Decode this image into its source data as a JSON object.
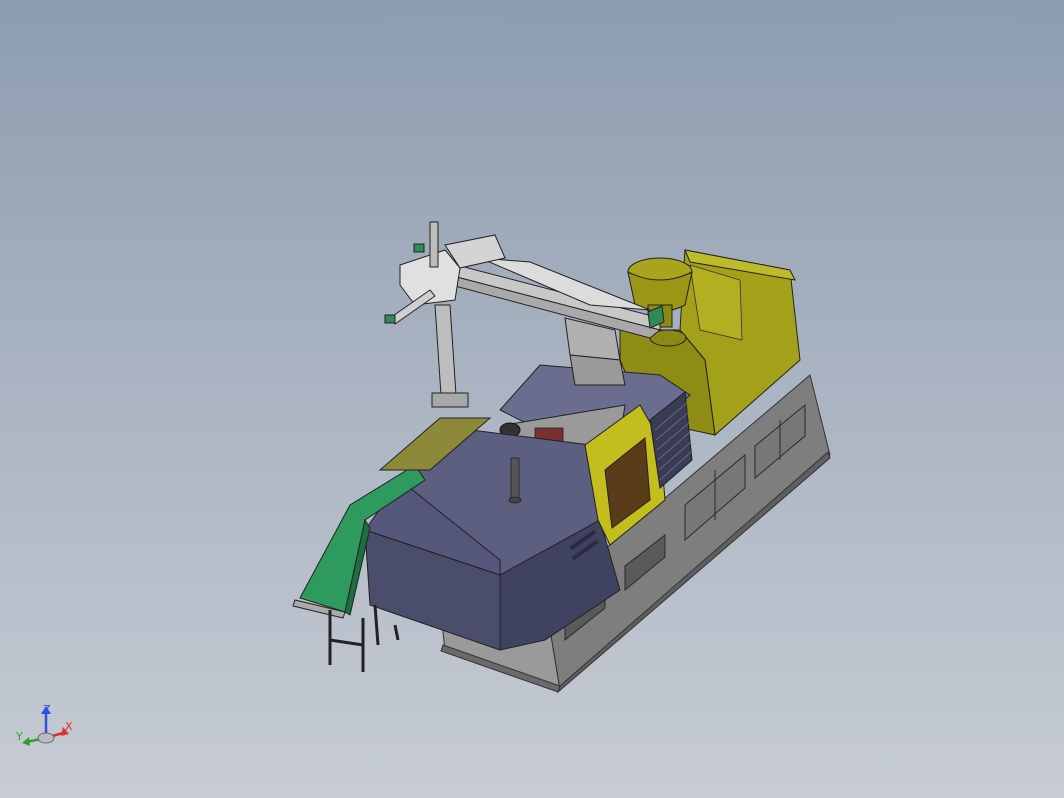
{
  "viewport": {
    "background_top": "#8d9cb0",
    "background_bottom": "#c7ccd4"
  },
  "model": {
    "colors": {
      "machine_body": "#5c5f80",
      "machine_body_dark": "#3f4260",
      "hopper_yellow": "#a3a11a",
      "panel_yellow": "#c4bd1e",
      "door_window": "#5a3c1a",
      "base_gray": "#8a8a8a",
      "base_dark": "#6c6c6c",
      "conveyor_green": "#2e9a5e",
      "robot_arm": "#c8c8c8",
      "robot_end_green": "#2f8a55"
    },
    "brand_text": "",
    "components": [
      "injection-molding-machine",
      "robot-arm",
      "hopper",
      "conveyor-belt",
      "machine-base"
    ]
  },
  "triad": {
    "z_label": "Z",
    "x_label": "X",
    "y_label": "Y",
    "x_color": "#e03030",
    "y_color": "#30a030",
    "z_color": "#3050e0"
  }
}
